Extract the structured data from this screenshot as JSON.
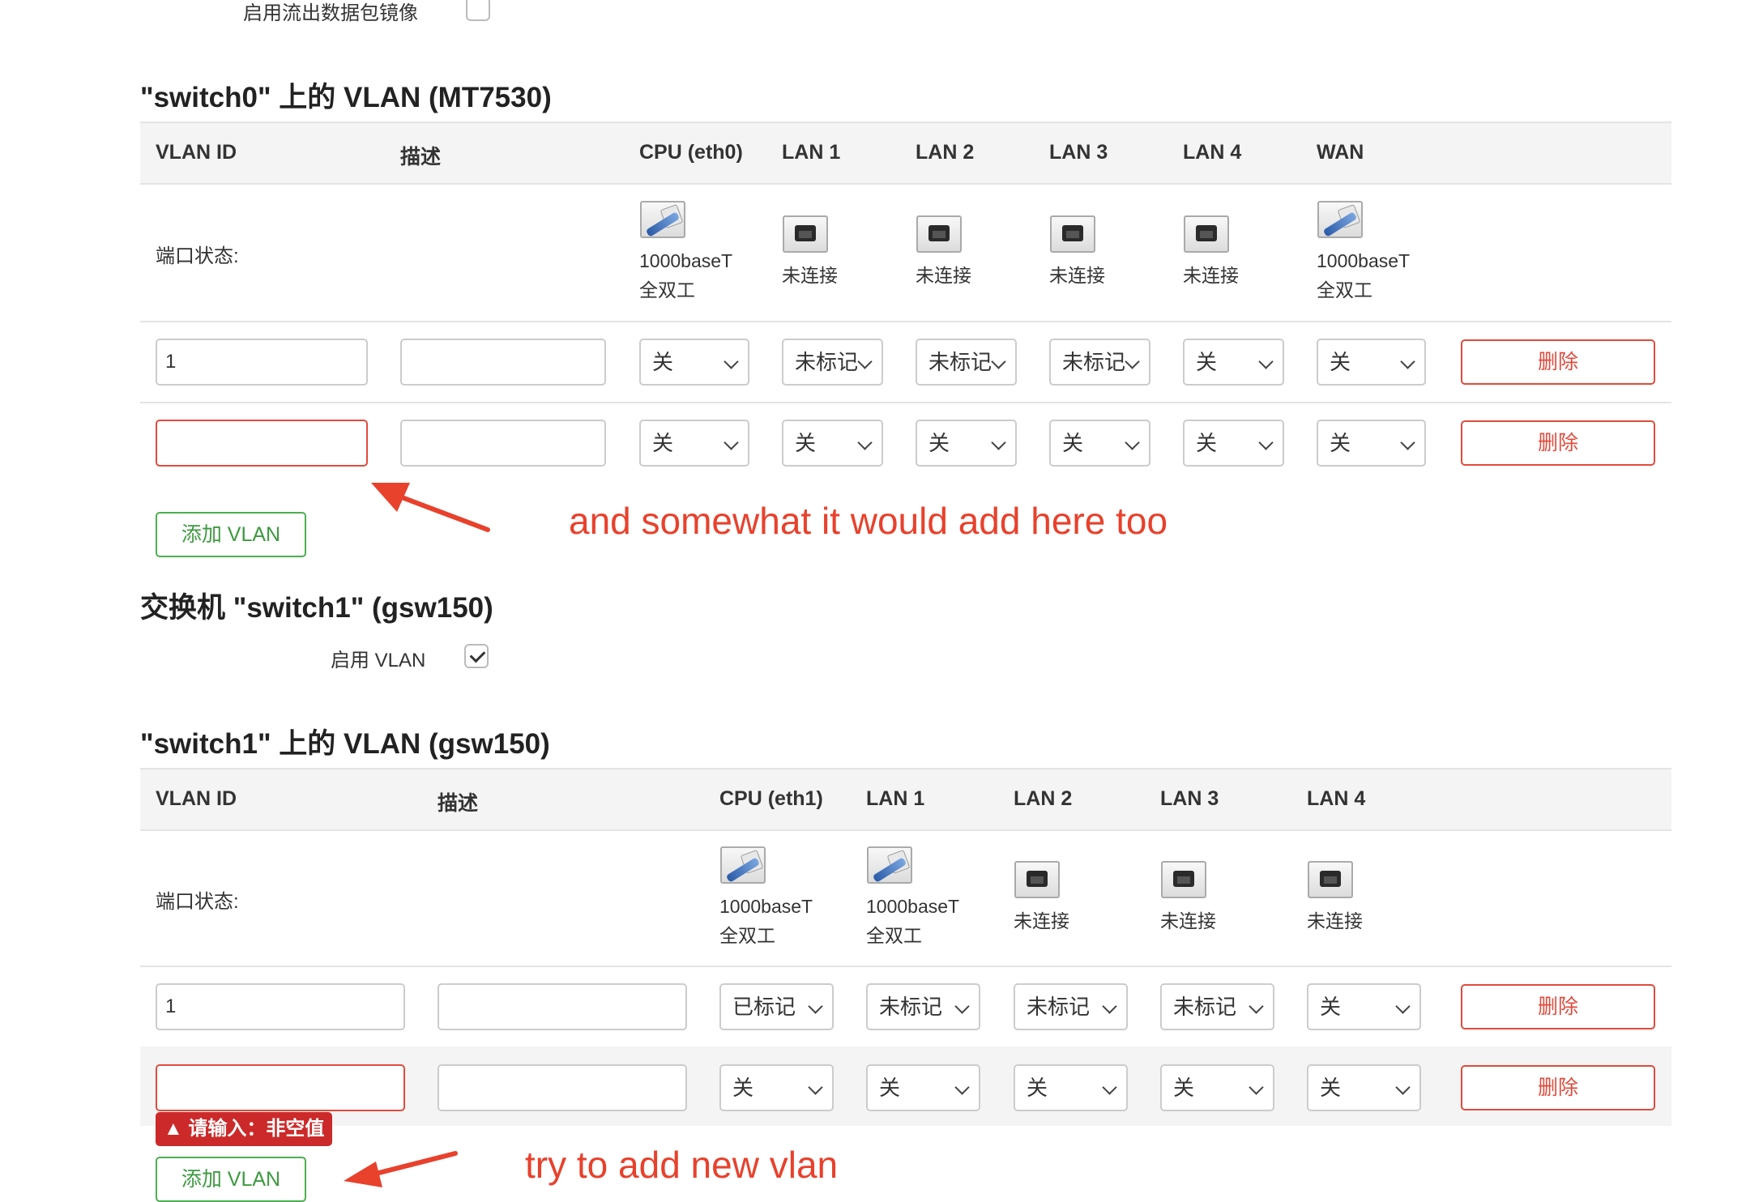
{
  "top": {
    "mirror_label": "启用流出数据包镜像",
    "mirror_checked": false
  },
  "switch0": {
    "title": "\"switch0\" 上的 VLAN (MT7530)",
    "headers": {
      "vlan_id": "VLAN ID",
      "desc": "描述",
      "cpu": "CPU (eth0)",
      "lan1": "LAN 1",
      "lan2": "LAN 2",
      "lan3": "LAN 3",
      "lan4": "LAN 4",
      "wan": "WAN"
    },
    "port_status_label": "端口状态:",
    "ports": [
      {
        "state": "up",
        "line1": "1000baseT",
        "line2": "全双工"
      },
      {
        "state": "down",
        "line1": "未连接",
        "line2": ""
      },
      {
        "state": "down",
        "line1": "未连接",
        "line2": ""
      },
      {
        "state": "down",
        "line1": "未连接",
        "line2": ""
      },
      {
        "state": "down",
        "line1": "未连接",
        "line2": ""
      },
      {
        "state": "up",
        "line1": "1000baseT",
        "line2": "全双工"
      }
    ],
    "rows": [
      {
        "vlan_id": "1",
        "desc": "",
        "cpu": "关",
        "lan1": "未标记",
        "lan2": "未标记",
        "lan3": "未标记",
        "lan4": "关",
        "wan": "关",
        "delete": "删除"
      },
      {
        "vlan_id": "",
        "desc": "",
        "cpu": "关",
        "lan1": "关",
        "lan2": "关",
        "lan3": "关",
        "lan4": "关",
        "wan": "关",
        "delete": "删除"
      }
    ],
    "add_button": "添加 VLAN"
  },
  "switch1_section": {
    "title": "交换机 \"switch1\" (gsw150)",
    "enable_vlan_label": "启用 VLAN",
    "enable_vlan_checked": true
  },
  "switch1": {
    "title": "\"switch1\" 上的 VLAN (gsw150)",
    "headers": {
      "vlan_id": "VLAN ID",
      "desc": "描述",
      "cpu": "CPU (eth1)",
      "lan1": "LAN 1",
      "lan2": "LAN 2",
      "lan3": "LAN 3",
      "lan4": "LAN 4"
    },
    "port_status_label": "端口状态:",
    "ports": [
      {
        "state": "up",
        "line1": "1000baseT",
        "line2": "全双工"
      },
      {
        "state": "up",
        "line1": "1000baseT",
        "line2": "全双工"
      },
      {
        "state": "down",
        "line1": "未连接",
        "line2": ""
      },
      {
        "state": "down",
        "line1": "未连接",
        "line2": ""
      },
      {
        "state": "down",
        "line1": "未连接",
        "line2": ""
      }
    ],
    "rows": [
      {
        "vlan_id": "1",
        "desc": "",
        "cpu": "已标记",
        "lan1": "未标记",
        "lan2": "未标记",
        "lan3": "未标记",
        "lan4": "关",
        "delete": "删除"
      },
      {
        "vlan_id": "",
        "desc": "",
        "cpu": "关",
        "lan1": "关",
        "lan2": "关",
        "lan3": "关",
        "lan4": "关",
        "delete": "删除"
      }
    ],
    "validation_tooltip": "▲ 请输入：非空值",
    "add_button": "添加 VLAN"
  },
  "annotations": {
    "note1": "and somewhat it would add here too",
    "note2": "try to add new vlan",
    "color": "#e8412c"
  }
}
